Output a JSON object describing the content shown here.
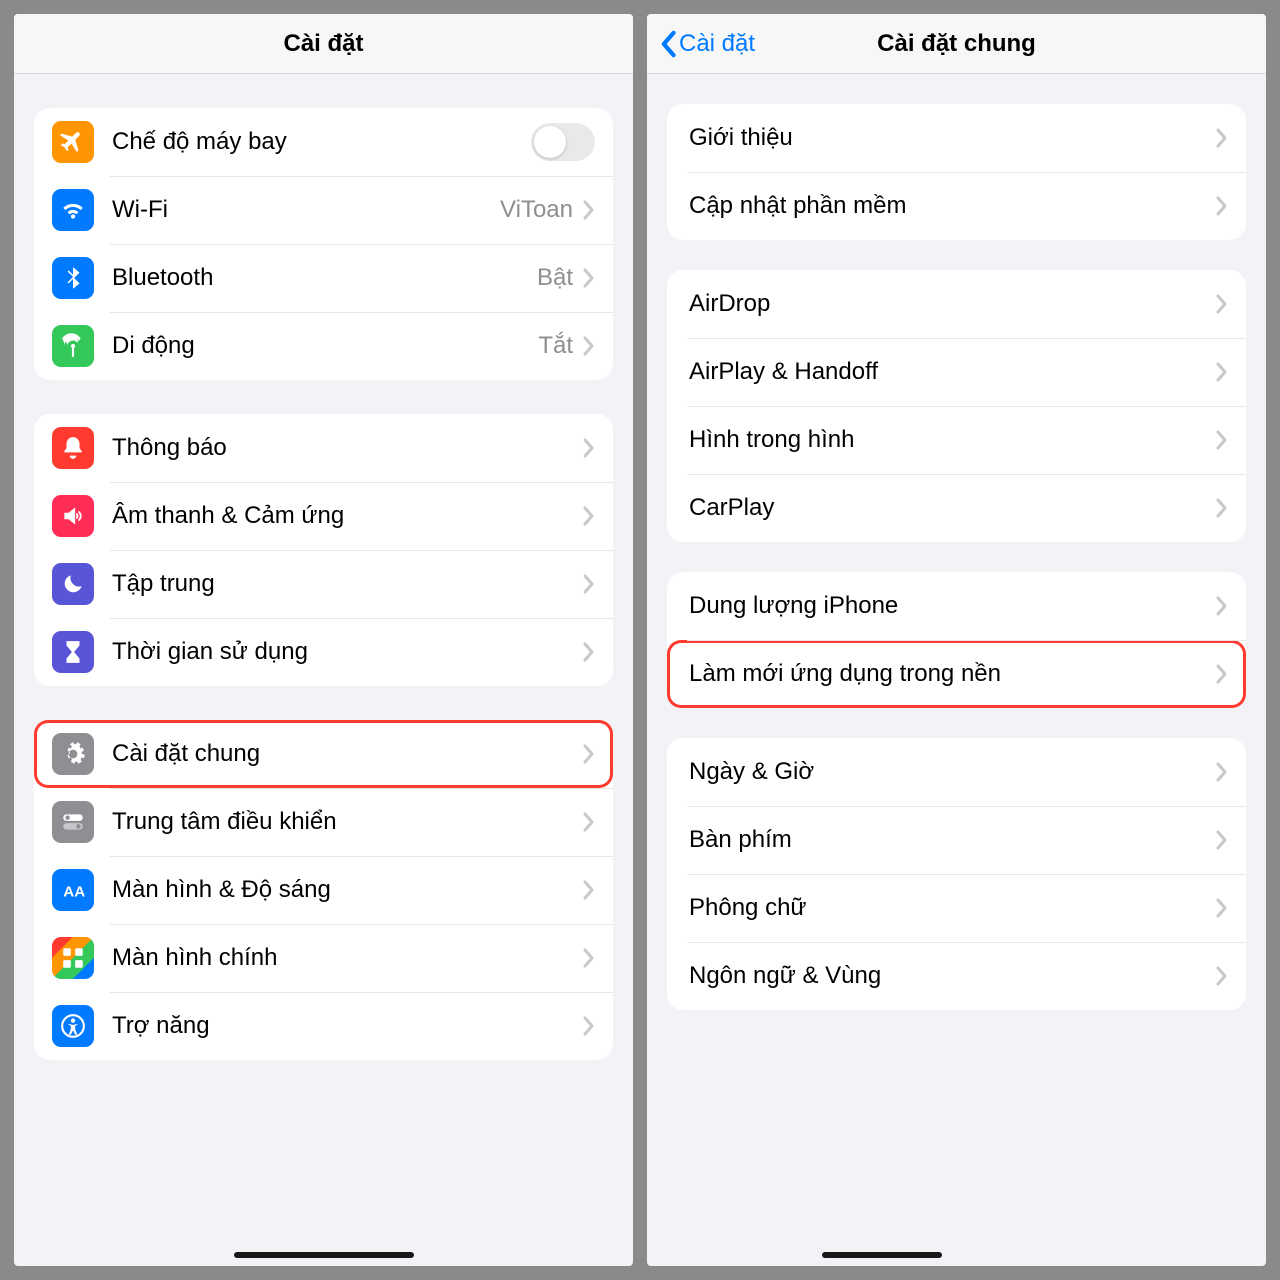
{
  "left": {
    "title": "Cài đặt",
    "groups": [
      {
        "rows": [
          {
            "id": "airplane",
            "label": "Chế độ máy bay",
            "icon": "plane",
            "color": "bg-orange",
            "toggle": true
          },
          {
            "id": "wifi",
            "label": "Wi-Fi",
            "value": "ViToan",
            "icon": "wifi",
            "color": "bg-blue"
          },
          {
            "id": "bluetooth",
            "label": "Bluetooth",
            "value": "Bật",
            "icon": "bt",
            "color": "bg-blue"
          },
          {
            "id": "cellular",
            "label": "Di động",
            "value": "Tắt",
            "icon": "antenna",
            "color": "bg-green"
          }
        ]
      },
      {
        "rows": [
          {
            "id": "notifications",
            "label": "Thông báo",
            "icon": "bell",
            "color": "bg-red"
          },
          {
            "id": "sounds",
            "label": "Âm thanh & Cảm ứng",
            "icon": "speaker",
            "color": "bg-pink"
          },
          {
            "id": "focus",
            "label": "Tập trung",
            "icon": "moon",
            "color": "bg-indigo"
          },
          {
            "id": "screentime",
            "label": "Thời gian sử dụng",
            "icon": "hourglass",
            "color": "bg-indigo"
          }
        ]
      },
      {
        "rows": [
          {
            "id": "general",
            "label": "Cài đặt chung",
            "icon": "gear",
            "color": "bg-gray",
            "highlight": true
          },
          {
            "id": "controlcenter",
            "label": "Trung tâm điều khiển",
            "icon": "switches",
            "color": "bg-gray"
          },
          {
            "id": "display",
            "label": "Màn hình & Độ sáng",
            "icon": "aa",
            "color": "bg-blue"
          },
          {
            "id": "homescreen",
            "label": "Màn hình chính",
            "icon": "grid",
            "color": "multi"
          },
          {
            "id": "accessibility",
            "label": "Trợ năng",
            "icon": "access",
            "color": "bg-blue"
          }
        ]
      }
    ]
  },
  "right": {
    "back": "Cài đặt",
    "title": "Cài đặt chung",
    "groups": [
      {
        "rows": [
          {
            "id": "about",
            "label": "Giới thiệu"
          },
          {
            "id": "update",
            "label": "Cập nhật phần mềm"
          }
        ]
      },
      {
        "rows": [
          {
            "id": "airdrop",
            "label": "AirDrop"
          },
          {
            "id": "airplay",
            "label": "AirPlay & Handoff"
          },
          {
            "id": "pip",
            "label": "Hình trong hình"
          },
          {
            "id": "carplay",
            "label": "CarPlay"
          }
        ]
      },
      {
        "rows": [
          {
            "id": "storage",
            "label": "Dung lượng iPhone"
          },
          {
            "id": "bgrefresh",
            "label": "Làm mới ứng dụng trong nền",
            "highlight": true
          }
        ]
      },
      {
        "rows": [
          {
            "id": "datetime",
            "label": "Ngày & Giờ"
          },
          {
            "id": "keyboard",
            "label": "Bàn phím"
          },
          {
            "id": "fonts",
            "label": "Phông chữ"
          },
          {
            "id": "language",
            "label": "Ngôn ngữ & Vùng"
          }
        ]
      }
    ]
  }
}
